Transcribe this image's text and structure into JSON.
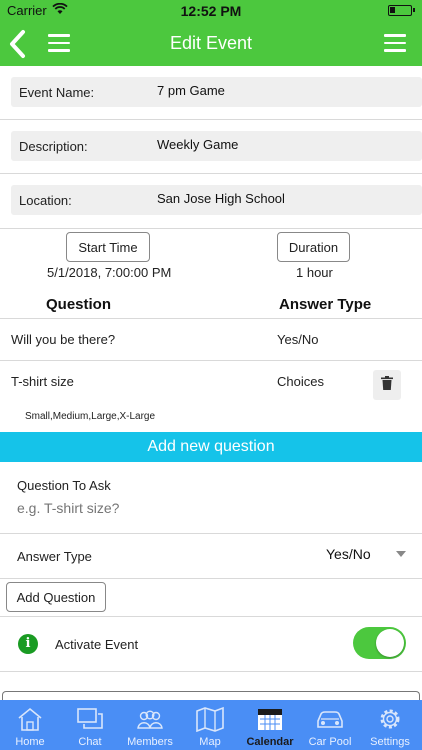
{
  "status_bar": {
    "carrier": "Carrier",
    "time": "12:52 PM"
  },
  "header": {
    "title": "Edit Event"
  },
  "form": {
    "event_name": {
      "label": "Event Name:",
      "value": "7 pm Game"
    },
    "description": {
      "label": "Description:",
      "value": "Weekly Game"
    },
    "location": {
      "label": "Location:",
      "value": "San Jose High School"
    }
  },
  "schedule": {
    "start_time_button": "Start Time",
    "start_time_value": "5/1/2018, 7:00:00 PM",
    "duration_button": "Duration",
    "duration_value": "1 hour"
  },
  "questions": {
    "col_question": "Question",
    "col_answer_type": "Answer Type",
    "rows": [
      {
        "question": "Will you be there?",
        "answer_type": "Yes/No"
      },
      {
        "question": "T-shirt size",
        "answer_type": "Choices",
        "choices": "Small,Medium,Large,X-Large"
      }
    ]
  },
  "add_question": {
    "header": "Add new question",
    "question_label": "Question To Ask",
    "question_placeholder": "e.g. T-shirt size?",
    "answer_type_label": "Answer Type",
    "answer_type_value": "Yes/No",
    "add_button": "Add Question"
  },
  "activate": {
    "label": "Activate Event",
    "enabled": true
  },
  "tabs": [
    {
      "label": "Home",
      "icon": "home-icon"
    },
    {
      "label": "Chat",
      "icon": "chat-icon"
    },
    {
      "label": "Members",
      "icon": "members-icon"
    },
    {
      "label": "Map",
      "icon": "map-icon"
    },
    {
      "label": "Calendar",
      "icon": "calendar-icon",
      "active": true
    },
    {
      "label": "Car Pool",
      "icon": "car-icon"
    },
    {
      "label": "Settings",
      "icon": "gear-icon"
    }
  ],
  "colors": {
    "primary_green": "#4cc83e",
    "accent_cyan": "#15c3e9",
    "tab_blue": "#4a8ef5"
  }
}
